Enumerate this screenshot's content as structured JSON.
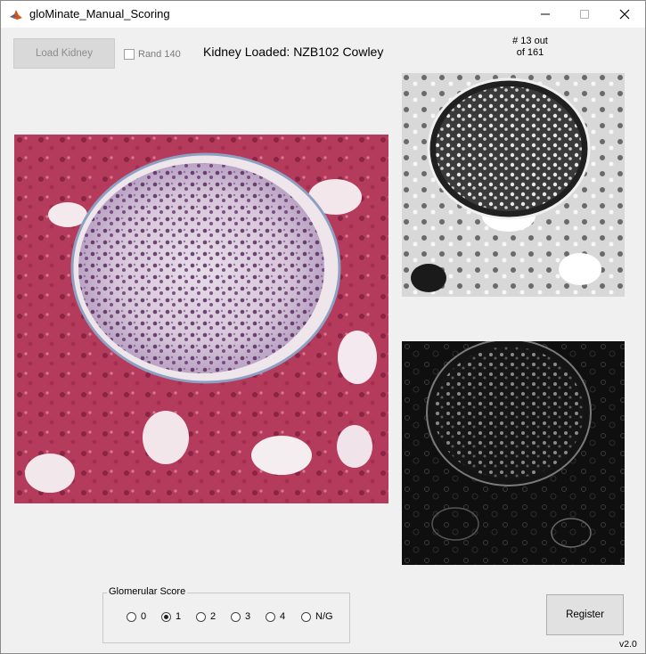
{
  "window": {
    "title": "gloMinate_Manual_Scoring",
    "icon": "matlab-icon",
    "controls": [
      "minimize-icon",
      "maximize-icon",
      "close-icon"
    ]
  },
  "toolbar": {
    "load_label": "Load Kidney",
    "rand_label": "Rand 140",
    "rand_checked": false,
    "kidney_label": "Kidney Loaded: NZB102 Cowley"
  },
  "counter": {
    "line1": "# 13 out",
    "line2": "of 161"
  },
  "images": {
    "main": "stained-glomerulus-image",
    "processed_top": "grayscale-glomerulus-image",
    "processed_bottom": "edge-filtered-glomerulus-image"
  },
  "score": {
    "title": "Glomerular Score",
    "options": [
      "0",
      "1",
      "2",
      "3",
      "4",
      "N/G"
    ],
    "selected": "1"
  },
  "register_label": "Register",
  "version": "v2.0",
  "colors": {
    "window_bg": "#f0f0f0",
    "stain_red": "#b4375a",
    "stain_purple": "#6a3a78"
  }
}
